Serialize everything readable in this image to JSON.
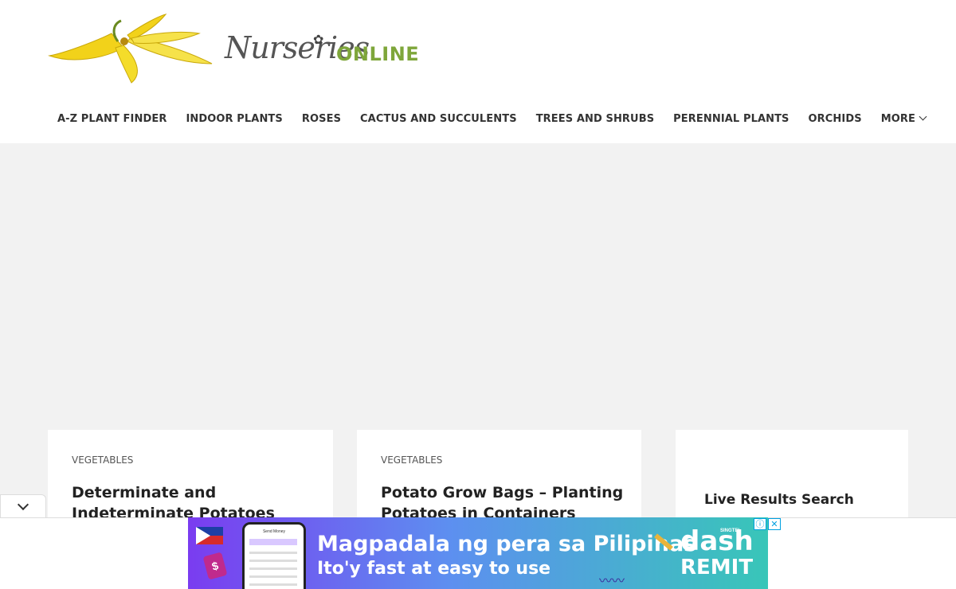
{
  "logo": {
    "script_text": "Nurseries",
    "bold_text": "ONLINE"
  },
  "nav": {
    "items": [
      "A-Z PLANT FINDER",
      "INDOOR PLANTS",
      "ROSES",
      "CACTUS AND SUCCULENTS",
      "TREES AND SHRUBS",
      "PERENNIAL PLANTS",
      "ORCHIDS",
      "MORE"
    ]
  },
  "cards": [
    {
      "category": "VEGETABLES",
      "title": "Determinate and Indeterminate Potatoes"
    },
    {
      "category": "VEGETABLES",
      "title": "Potato Grow Bags – Planting Potatoes in Containers"
    }
  ],
  "widget": {
    "title": "Live Results Search"
  },
  "ad": {
    "headline": "Magpadala ng pera sa Pilipinas",
    "subline": "Ito'y fast at easy to use",
    "brand_small": "SINGTEL",
    "brand_main": "dash",
    "brand_sub": "REMIT",
    "phone_title": "Send Money",
    "info_icon": "ⓘ",
    "close_icon": "✕"
  },
  "colors": {
    "accent_green": "#7ea63a",
    "nav_text": "#333333",
    "page_bg": "#f2f2f2"
  }
}
